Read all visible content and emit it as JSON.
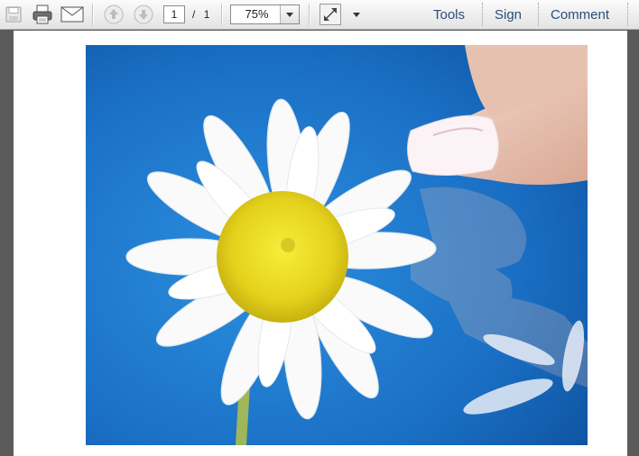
{
  "toolbar": {
    "icons": [
      "save-icon",
      "print-icon",
      "email-icon",
      "previous-page-icon",
      "next-page-icon",
      "fit-page-icon",
      "more-options-icon"
    ],
    "page_current": "1",
    "page_separator": "/",
    "page_total": "1",
    "zoom": "75%"
  },
  "right_links": {
    "tools": "Tools",
    "sign": "Sign",
    "comment": "Comment"
  },
  "colors": {
    "link": "#2c4e79",
    "frame": "#5b5b5b",
    "sky": "#1f7fd0"
  }
}
